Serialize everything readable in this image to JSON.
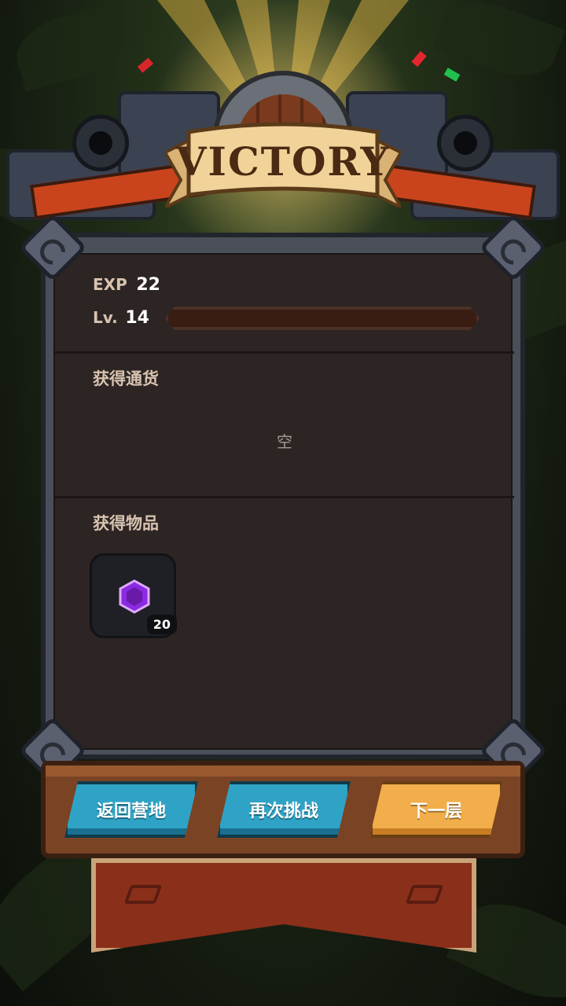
{
  "header": {
    "title": "VICTORY"
  },
  "exp": {
    "label": "EXP",
    "value": "22"
  },
  "level": {
    "label": "Lv.",
    "value": "14",
    "progress": 0.0
  },
  "currency": {
    "title": "获得通货",
    "empty_text": "空"
  },
  "items": {
    "title": "获得物品",
    "list": [
      {
        "icon": "purple-cube-icon",
        "count": "20"
      }
    ]
  },
  "buttons": {
    "return_camp": "返回营地",
    "retry": "再次挑战",
    "next_floor": "下一层"
  },
  "colors": {
    "button_blue": "#2fa3c6",
    "button_gold": "#f1ae4a",
    "panel_bg": "#2c2523",
    "gem_purple": "#8a2be2"
  }
}
